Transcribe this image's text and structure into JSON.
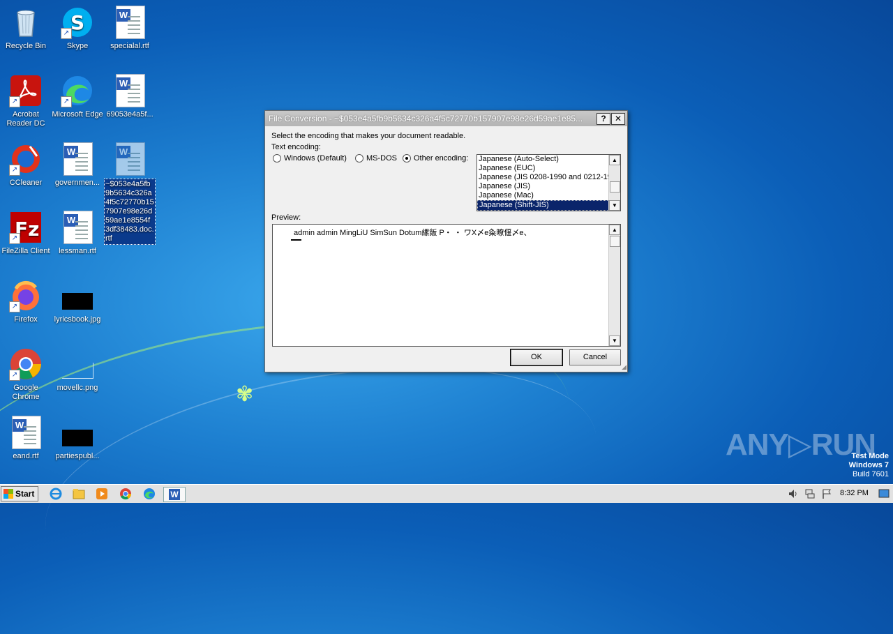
{
  "desktop": {
    "icons": [
      {
        "label": "Recycle Bin"
      },
      {
        "label": "Skype"
      },
      {
        "label": "specialal.rtf"
      },
      {
        "label": "Acrobat Reader DC"
      },
      {
        "label": "Microsoft Edge"
      },
      {
        "label": "69053e4a5f..."
      },
      {
        "label": "CCleaner"
      },
      {
        "label": "governmen..."
      },
      {
        "label": "~$053e4a5fb9b5634c326a4f5c72770b157907e98e26d59ae1e8554f3df38483.doc.rtf"
      },
      {
        "label": "FileZilla Client"
      },
      {
        "label": "lessman.rtf"
      },
      {
        "label": "Firefox"
      },
      {
        "label": "lyricsbook.jpg"
      },
      {
        "label": "Google Chrome"
      },
      {
        "label": "movellc.png"
      },
      {
        "label": "eand.rtf"
      },
      {
        "label": "partiespubl..."
      }
    ]
  },
  "dialog": {
    "title": "File Conversion - ~$053e4a5fb9b5634c326a4f5c72770b157907e98e26d59ae1e85...",
    "help_label": "?",
    "close_label": "✕",
    "instruction": "Select the encoding that makes your document readable.",
    "text_encoding_label": "Text encoding:",
    "radio_windows": "Windows (Default)",
    "radio_msdos": "MS-DOS",
    "radio_other": "Other encoding:",
    "encodings": [
      "Japanese (Auto-Select)",
      "Japanese (EUC)",
      "Japanese (JIS 0208-1990 and 0212-19",
      "Japanese (JIS)",
      "Japanese (Mac)",
      "Japanese (Shift-JIS)"
    ],
    "selected_encoding": "Japanese (Shift-JIS)",
    "preview_label": "Preview:",
    "preview_text": "admin admin MingLiU SimSun Dotum縲飯 P・ ・ ワX〆e粂暸偃〆e、",
    "ok_label": "OK",
    "cancel_label": "Cancel"
  },
  "taskbar": {
    "start_label": "Start",
    "clock": "8:32 PM"
  },
  "watermark": {
    "brand": "ANY▷RUN",
    "line1": "Test Mode",
    "line2": "Windows 7",
    "line3": "Build 7601"
  }
}
